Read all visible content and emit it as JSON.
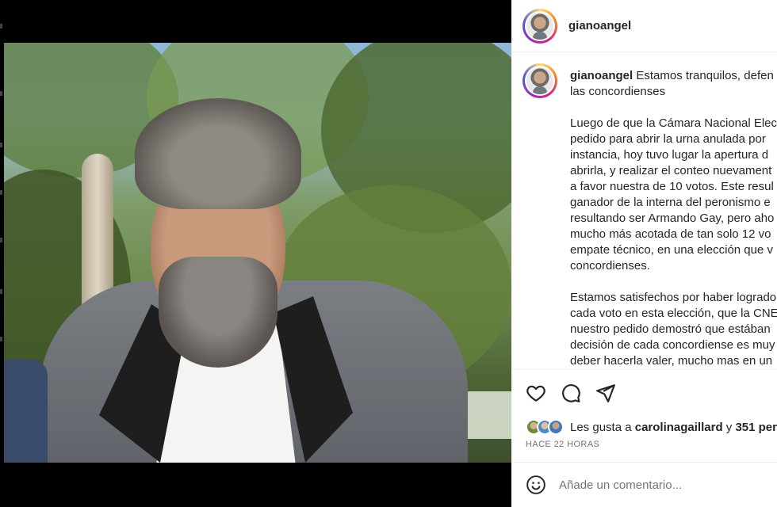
{
  "post": {
    "username": "gianoangel",
    "caption_lines": [
      "Estamos tranquilos, defen",
      "las concordienses"
    ],
    "paragraph1": [
      "Luego de que la Cámara Nacional Elec",
      "pedido para abrir la urna anulada por",
      "instancia, hoy tuvo lugar la apertura d",
      "abrirla, y realizar el conteo nuevament",
      "a favor nuestra de 10 votos. Este resul",
      "ganador de la interna del peronismo e",
      "resultando ser Armando Gay, pero aho",
      "mucho más acotada de tan solo 12 vo",
      "empate técnico, en una elección que v",
      "concordienses."
    ],
    "paragraph2": [
      "Estamos satisfechos por haber logrado",
      "cada voto en esta elección, que la CNE",
      "nuestro pedido demostró que estában",
      "decisión de cada concordiense es muy",
      "deber hacerla valer, mucho mas en un"
    ]
  },
  "actions": {
    "like_icon": "heart-icon",
    "comment_icon": "comment-icon",
    "share_icon": "send-icon"
  },
  "likes": {
    "prefix": "Les gusta a",
    "user": "carolinagaillard",
    "connector": "y",
    "count": "351 per"
  },
  "timestamp": "HACE 22 HORAS",
  "comment": {
    "placeholder": "Añade un comentario...",
    "emoji_icon": "emoji-icon"
  },
  "colors": {
    "story_ring": [
      "#feda75",
      "#fa7e1e",
      "#d62976",
      "#962fbf",
      "#4f5bd5"
    ],
    "text": "#262626",
    "muted": "#737373"
  }
}
